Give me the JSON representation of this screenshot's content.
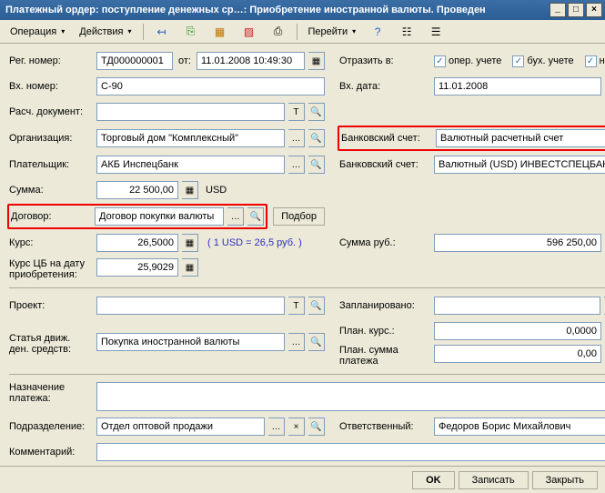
{
  "window": {
    "title": "Платежный ордер: поступление денежных ср…: Приобретение иностранной валюты. Проведен"
  },
  "toolbar": {
    "operation": "Операция",
    "actions": "Действия",
    "go": "Перейти"
  },
  "left": {
    "reg_num_lbl": "Рег. номер:",
    "reg_num": "ТД000000001",
    "ot_lbl": "от:",
    "reg_date": "11.01.2008 10:49:30",
    "vh_num_lbl": "Вх. номер:",
    "vh_num": "С-90",
    "rasch_doc_lbl": "Расч. документ:",
    "rasch_doc": "",
    "org_lbl": "Организация:",
    "org": "Торговый дом \"Комплексный\"",
    "payer_lbl": "Плательщик:",
    "payer": "АКБ Инспецбанк",
    "sum_lbl": "Сумма:",
    "sum": "22 500,00",
    "sum_cur": "USD",
    "dogovor_lbl": "Договор:",
    "dogovor": "Договор покупки валюты",
    "podbor": "Подбор",
    "kurs_lbl": "Курс:",
    "kurs": "26,5000",
    "kurs_note": "( 1 USD = 26,5 руб. )",
    "kurs_cb_lbl": "Курс ЦБ на дату приобретения:",
    "kurs_cb": "25,9029",
    "proekt_lbl": "Проект:",
    "proekt": "",
    "stat_lbl": "Статья движ. ден. средств:",
    "stat": "Покупка иностранной валюты",
    "nazn_lbl": "Назначение платежа:",
    "nazn": "",
    "podr_lbl": "Подразделение:",
    "podr": "Отдел оптовой продажи",
    "comment_lbl": "Комментарий:",
    "comment": ""
  },
  "right": {
    "otrazit_lbl": "Отразить в:",
    "chk_oper": "опер. учете",
    "chk_bux": "бух. учете",
    "chk_nal": "нал. учете",
    "vh_date_lbl": "Вх. дата:",
    "vh_date": "11.01.2008",
    "bank1_lbl": "Банковский счет:",
    "bank1": "Валютный расчетный счет",
    "bank2_lbl": "Банковский счет:",
    "bank2": "Валютный (USD) ИНВЕСТСПЕЦБАНК",
    "sumrub_lbl": "Сумма руб.:",
    "sumrub": "596 250,00",
    "plan_lbl": "Запланировано:",
    "plan": "",
    "plankurs_lbl": "План. курс.:",
    "plankurs": "0,0000",
    "plansum_lbl": "План. сумма платежа",
    "plansum": "0,00",
    "otv_lbl": "Ответственный:",
    "otv": "Федоров Борис Михайлович"
  },
  "footer": {
    "ok": "OK",
    "save": "Записать",
    "close": "Закрыть"
  }
}
